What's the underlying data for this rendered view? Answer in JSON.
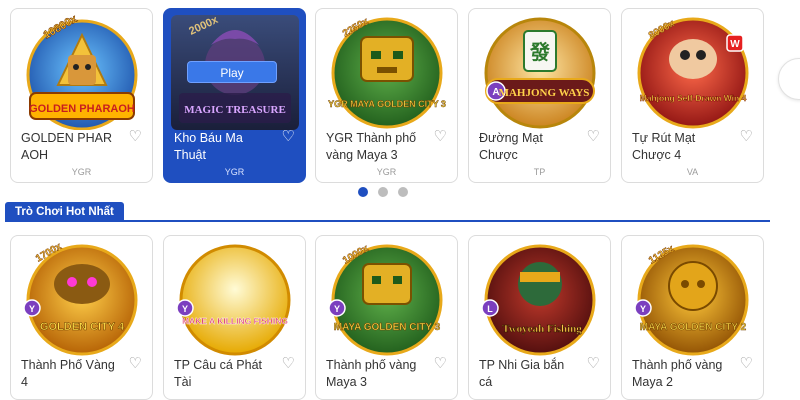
{
  "featured": {
    "play_label": "Play",
    "pagination_dots": 3,
    "active_dot": 0,
    "games": [
      {
        "name": "GOLDEN PHAR AOH",
        "provider": "YGR",
        "multiplier": "10800x",
        "art_title": "GOLDEN PHARAOH",
        "active": false
      },
      {
        "name": "Kho Báu Ma Thuật",
        "provider": "YGR",
        "multiplier": "2000x",
        "art_title": "MAGIC TREASURE",
        "active": true
      },
      {
        "name": "YGR Thành phố vàng Maya 3",
        "provider": "YGR",
        "multiplier": "2250x",
        "art_title": "YGR MAYA GOLDEN CITY 3",
        "active": false
      },
      {
        "name": "Đường Mạt Chược",
        "provider": "TP",
        "multiplier": "",
        "art_title": "MAHJONG WAYS",
        "active": false
      },
      {
        "name": "Tự Rút Mạt Chược 4",
        "provider": "VA",
        "multiplier": "8000x",
        "art_title": "Mahjong Self-Drawn Win 4",
        "active": false
      }
    ]
  },
  "hot_section": {
    "tab_label": "Trò Chơi Hot Nhất",
    "games": [
      {
        "name": "Thành Phố Vàng 4",
        "multiplier": "1700x",
        "art_title": "GOLDEN CITY 4"
      },
      {
        "name": "TP Câu cá Phát Tài",
        "multiplier": "",
        "art_title": "MAKE A KILLING FISHING"
      },
      {
        "name": "Thành phố vàng Maya 3",
        "multiplier": "1000x",
        "art_title": "MAYA GOLDEN CITY 3"
      },
      {
        "name": "TP Nhi Gia bắn cá",
        "multiplier": "",
        "art_title": "Twoyeah Fishing"
      },
      {
        "name": "Thành phố vàng Maya 2",
        "multiplier": "1125x",
        "art_title": "MAYA GOLDEN CITY 2"
      }
    ]
  },
  "colors": {
    "accent": "#1f4fc0",
    "gold": "#e8a91a",
    "text": "#333333"
  }
}
